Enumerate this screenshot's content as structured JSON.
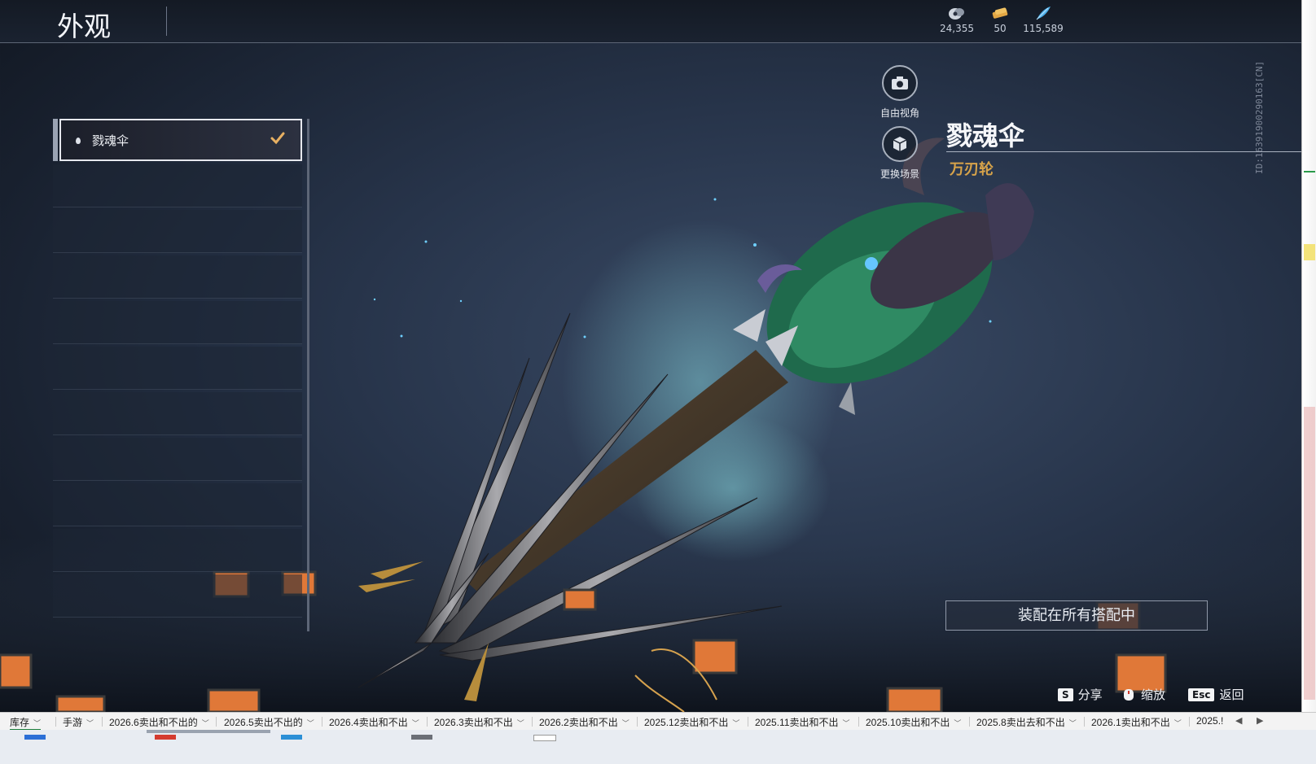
{
  "header": {
    "title": "外观",
    "currencies": [
      {
        "icon": "coin-pouch-icon",
        "value": "24,355"
      },
      {
        "icon": "ticket-icon",
        "value": "50"
      },
      {
        "icon": "feather-icon",
        "value": "115,589"
      }
    ]
  },
  "vertical_id": "ID:16391900290163[CN]",
  "skin_list": {
    "items": [
      {
        "label": "戮魂伞",
        "selected": true
      }
    ]
  },
  "viewer": {
    "free_camera_label": "自由视角",
    "change_scene_label": "更换场景"
  },
  "item": {
    "name": "戮魂伞",
    "subtitle": "万刃轮"
  },
  "equip_button": "装配在所有搭配中",
  "hints": [
    {
      "key": "S",
      "label": "分享"
    },
    {
      "key": "",
      "icon": "mouse-icon",
      "label": "缩放"
    },
    {
      "key": "Esc",
      "label": "返回"
    }
  ],
  "sheet_tabs": [
    "库存",
    "手游",
    "2026.6卖出和不出的",
    "2026.5卖出不出的",
    "2026.4卖出和不出",
    "2026.3卖出和不出",
    "2026.2卖出和不出",
    "2025.12卖出和不出",
    "2025.11卖出和不出",
    "2025.10卖出和不出",
    "2025.8卖出去和不出",
    "2026.1卖出和不出",
    "2025.!"
  ],
  "colors": {
    "accent_gold": "#d7a34a",
    "sheet_active": "#1a7d3a"
  }
}
